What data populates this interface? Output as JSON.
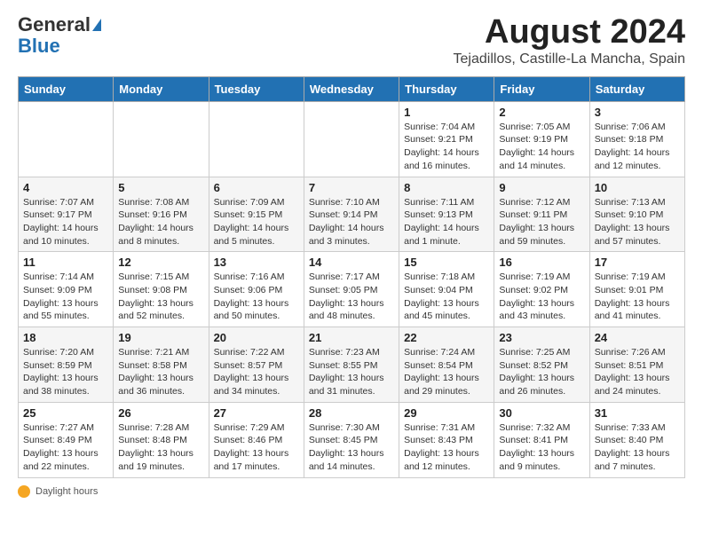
{
  "header": {
    "logo_general": "General",
    "logo_blue": "Blue",
    "month_year": "August 2024",
    "location": "Tejadillos, Castille-La Mancha, Spain"
  },
  "days_of_week": [
    "Sunday",
    "Monday",
    "Tuesday",
    "Wednesday",
    "Thursday",
    "Friday",
    "Saturday"
  ],
  "weeks": [
    [
      {
        "day": "",
        "detail": ""
      },
      {
        "day": "",
        "detail": ""
      },
      {
        "day": "",
        "detail": ""
      },
      {
        "day": "",
        "detail": ""
      },
      {
        "day": "1",
        "detail": "Sunrise: 7:04 AM\nSunset: 9:21 PM\nDaylight: 14 hours and 16 minutes."
      },
      {
        "day": "2",
        "detail": "Sunrise: 7:05 AM\nSunset: 9:19 PM\nDaylight: 14 hours and 14 minutes."
      },
      {
        "day": "3",
        "detail": "Sunrise: 7:06 AM\nSunset: 9:18 PM\nDaylight: 14 hours and 12 minutes."
      }
    ],
    [
      {
        "day": "4",
        "detail": "Sunrise: 7:07 AM\nSunset: 9:17 PM\nDaylight: 14 hours and 10 minutes."
      },
      {
        "day": "5",
        "detail": "Sunrise: 7:08 AM\nSunset: 9:16 PM\nDaylight: 14 hours and 8 minutes."
      },
      {
        "day": "6",
        "detail": "Sunrise: 7:09 AM\nSunset: 9:15 PM\nDaylight: 14 hours and 5 minutes."
      },
      {
        "day": "7",
        "detail": "Sunrise: 7:10 AM\nSunset: 9:14 PM\nDaylight: 14 hours and 3 minutes."
      },
      {
        "day": "8",
        "detail": "Sunrise: 7:11 AM\nSunset: 9:13 PM\nDaylight: 14 hours and 1 minute."
      },
      {
        "day": "9",
        "detail": "Sunrise: 7:12 AM\nSunset: 9:11 PM\nDaylight: 13 hours and 59 minutes."
      },
      {
        "day": "10",
        "detail": "Sunrise: 7:13 AM\nSunset: 9:10 PM\nDaylight: 13 hours and 57 minutes."
      }
    ],
    [
      {
        "day": "11",
        "detail": "Sunrise: 7:14 AM\nSunset: 9:09 PM\nDaylight: 13 hours and 55 minutes."
      },
      {
        "day": "12",
        "detail": "Sunrise: 7:15 AM\nSunset: 9:08 PM\nDaylight: 13 hours and 52 minutes."
      },
      {
        "day": "13",
        "detail": "Sunrise: 7:16 AM\nSunset: 9:06 PM\nDaylight: 13 hours and 50 minutes."
      },
      {
        "day": "14",
        "detail": "Sunrise: 7:17 AM\nSunset: 9:05 PM\nDaylight: 13 hours and 48 minutes."
      },
      {
        "day": "15",
        "detail": "Sunrise: 7:18 AM\nSunset: 9:04 PM\nDaylight: 13 hours and 45 minutes."
      },
      {
        "day": "16",
        "detail": "Sunrise: 7:19 AM\nSunset: 9:02 PM\nDaylight: 13 hours and 43 minutes."
      },
      {
        "day": "17",
        "detail": "Sunrise: 7:19 AM\nSunset: 9:01 PM\nDaylight: 13 hours and 41 minutes."
      }
    ],
    [
      {
        "day": "18",
        "detail": "Sunrise: 7:20 AM\nSunset: 8:59 PM\nDaylight: 13 hours and 38 minutes."
      },
      {
        "day": "19",
        "detail": "Sunrise: 7:21 AM\nSunset: 8:58 PM\nDaylight: 13 hours and 36 minutes."
      },
      {
        "day": "20",
        "detail": "Sunrise: 7:22 AM\nSunset: 8:57 PM\nDaylight: 13 hours and 34 minutes."
      },
      {
        "day": "21",
        "detail": "Sunrise: 7:23 AM\nSunset: 8:55 PM\nDaylight: 13 hours and 31 minutes."
      },
      {
        "day": "22",
        "detail": "Sunrise: 7:24 AM\nSunset: 8:54 PM\nDaylight: 13 hours and 29 minutes."
      },
      {
        "day": "23",
        "detail": "Sunrise: 7:25 AM\nSunset: 8:52 PM\nDaylight: 13 hours and 26 minutes."
      },
      {
        "day": "24",
        "detail": "Sunrise: 7:26 AM\nSunset: 8:51 PM\nDaylight: 13 hours and 24 minutes."
      }
    ],
    [
      {
        "day": "25",
        "detail": "Sunrise: 7:27 AM\nSunset: 8:49 PM\nDaylight: 13 hours and 22 minutes."
      },
      {
        "day": "26",
        "detail": "Sunrise: 7:28 AM\nSunset: 8:48 PM\nDaylight: 13 hours and 19 minutes."
      },
      {
        "day": "27",
        "detail": "Sunrise: 7:29 AM\nSunset: 8:46 PM\nDaylight: 13 hours and 17 minutes."
      },
      {
        "day": "28",
        "detail": "Sunrise: 7:30 AM\nSunset: 8:45 PM\nDaylight: 13 hours and 14 minutes."
      },
      {
        "day": "29",
        "detail": "Sunrise: 7:31 AM\nSunset: 8:43 PM\nDaylight: 13 hours and 12 minutes."
      },
      {
        "day": "30",
        "detail": "Sunrise: 7:32 AM\nSunset: 8:41 PM\nDaylight: 13 hours and 9 minutes."
      },
      {
        "day": "31",
        "detail": "Sunrise: 7:33 AM\nSunset: 8:40 PM\nDaylight: 13 hours and 7 minutes."
      }
    ]
  ],
  "footer": {
    "daylight_label": "Daylight hours"
  }
}
